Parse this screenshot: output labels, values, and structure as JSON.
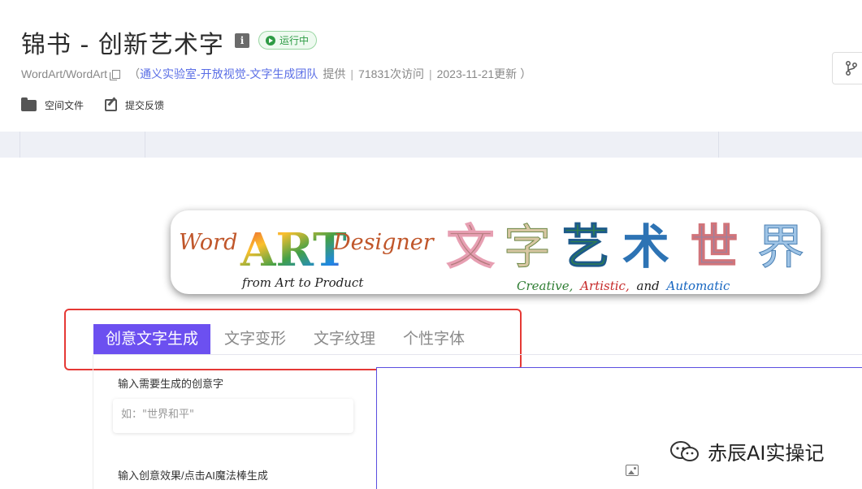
{
  "header": {
    "title": "锦书 - 创新艺术字",
    "info_icon_text": "i",
    "status": "运行中",
    "repo_path": "WordArt/WordArt",
    "provider_open": "（",
    "provider_team": "通义实验室-开放视觉-文字生成团队",
    "provider_suffix": "提供",
    "sep1": "|",
    "visits": "71831次访问",
    "sep2": "|",
    "updated": "2023-11-21更新",
    "provider_close": "）"
  },
  "actions": {
    "space_files": "空间文件",
    "feedback": "提交反馈"
  },
  "banner": {
    "word": "Word",
    "art": "ART",
    "designer": "Designer",
    "tagline": "from Art to Product",
    "chinese_chars": [
      "文",
      "字",
      "艺",
      "术",
      "世",
      "界"
    ],
    "creative": "Creative,",
    "artistic": "Artistic,",
    "and": "and",
    "automatic": "Automatic"
  },
  "tabs": [
    {
      "label": "创意文字生成",
      "active": true
    },
    {
      "label": "文字变形",
      "active": false
    },
    {
      "label": "文字纹理",
      "active": false
    },
    {
      "label": "个性字体",
      "active": false
    }
  ],
  "form": {
    "text_label": "输入需要生成的创意字",
    "text_placeholder": "如：\"世界和平\"",
    "effect_label": "输入创意效果/点击AI魔法棒生成"
  },
  "watermark": "赤辰AI实操记",
  "colors": {
    "accent": "#6c50f0",
    "status_green": "#2e9b45",
    "highlight_red": "#e53935",
    "link_blue": "#5a6ee6"
  }
}
